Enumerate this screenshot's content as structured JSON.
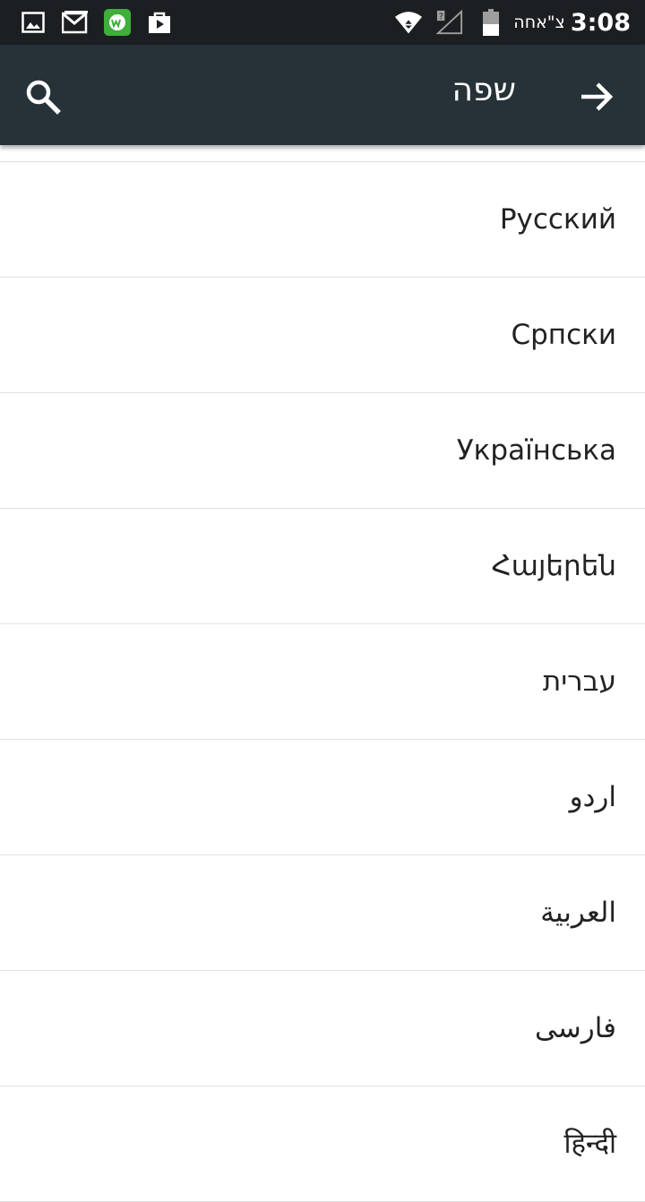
{
  "status_bar": {
    "left_icons": [
      "gallery-icon",
      "gmail-icon",
      "app-w-icon",
      "store-bag-icon"
    ],
    "right_icons": [
      "wifi-icon",
      "no-signal-icon",
      "battery-icon"
    ],
    "carrier": "צ\"אחה",
    "time": "3:08"
  },
  "toolbar": {
    "title": "שפה",
    "search_icon": "search-icon",
    "forward_icon": "arrow-forward-icon",
    "background": "#263238"
  },
  "languages": [
    "Русский",
    "Српски",
    "Українська",
    "Հայերեն",
    "עברית",
    "اردو",
    "العربية",
    "فارسی",
    "हिन्दी"
  ]
}
